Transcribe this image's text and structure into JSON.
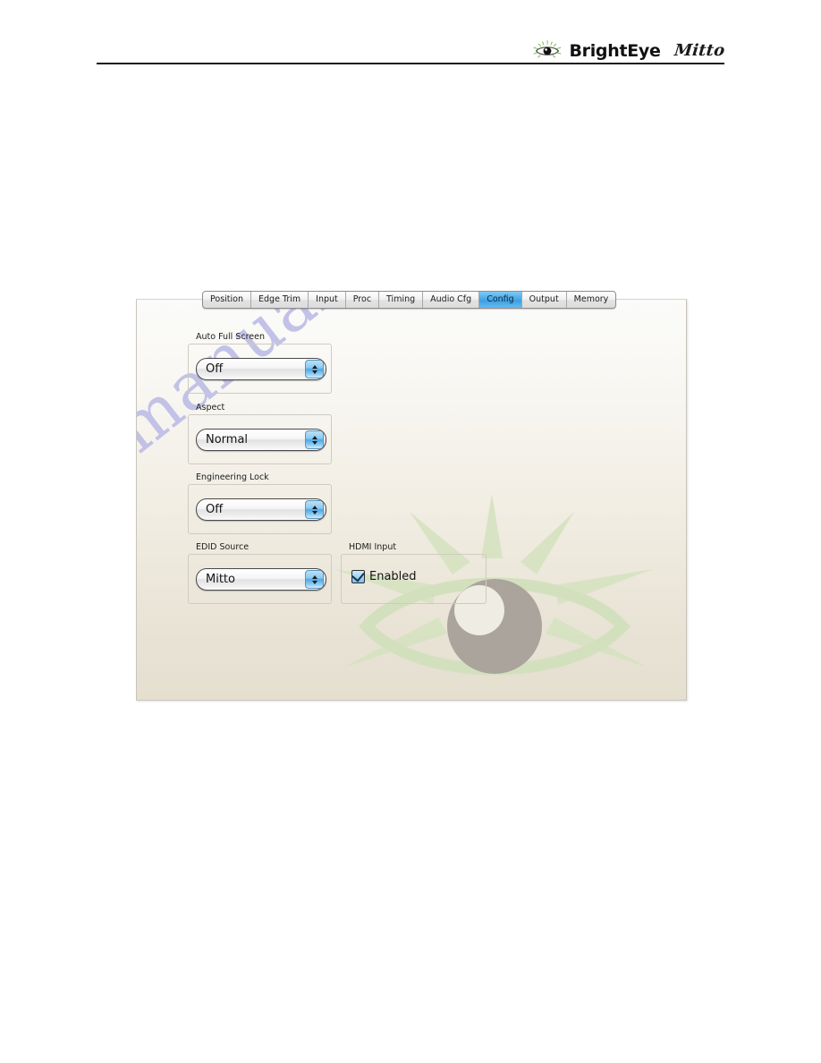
{
  "header": {
    "brand_name": "BrightEye",
    "model_name": "Mitto",
    "logo_icon": "brighteye-sun-eye-icon"
  },
  "tabs": [
    {
      "label": "Position",
      "active": false
    },
    {
      "label": "Edge Trim",
      "active": false
    },
    {
      "label": "Input",
      "active": false
    },
    {
      "label": "Proc",
      "active": false
    },
    {
      "label": "Timing",
      "active": false
    },
    {
      "label": "Audio Cfg",
      "active": false
    },
    {
      "label": "Config",
      "active": true
    },
    {
      "label": "Output",
      "active": false
    },
    {
      "label": "Memory",
      "active": false
    }
  ],
  "panel": {
    "active_tab": "Config",
    "watermark_text": "manualshive.com",
    "watermark_color": "#b9b9e6",
    "watermark_graphic": "eye-sun-logo",
    "groups": {
      "auto_full_screen": {
        "label": "Auto Full Screen",
        "value": "Off"
      },
      "aspect": {
        "label": "Aspect",
        "value": "Normal"
      },
      "engineering_lock": {
        "label": "Engineering Lock",
        "value": "Off"
      },
      "edid_source": {
        "label": "EDID Source",
        "value": "Mitto"
      },
      "hdmi_input": {
        "label": "HDMI Input",
        "checkbox_label": "Enabled",
        "checked": true
      }
    }
  },
  "colors": {
    "active_tab_blue": "#4aa9e8",
    "stepper_arrow_blue": "#8ecbf2",
    "checkbox_blue": "#9fd3f5",
    "panel_top": "#fbfbf9",
    "panel_bottom": "#e5dfd0",
    "logo_green": "#6cb93b"
  }
}
